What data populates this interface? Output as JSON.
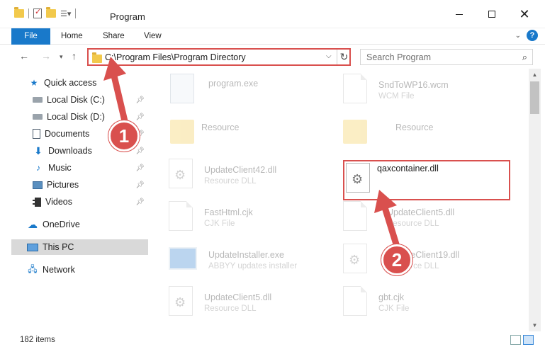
{
  "window": {
    "title": "Program",
    "minimize": "–",
    "maximize": "□",
    "close": "✕"
  },
  "ribbon": {
    "tabs": [
      "File",
      "Home",
      "Share",
      "View"
    ],
    "help": "?"
  },
  "address": {
    "path": "C:\\Program Files\\Program Directory",
    "refresh": "↻",
    "dropdown": "⌵"
  },
  "search": {
    "placeholder": "Search Program"
  },
  "nav": {
    "items": [
      {
        "label": "Quick access",
        "icon": "star-icon"
      },
      {
        "label": "Local Disk (C:)",
        "icon": "disk-icon",
        "pinned": true
      },
      {
        "label": "Local Disk (D:)",
        "icon": "disk-icon",
        "pinned": true
      },
      {
        "label": "Documents",
        "icon": "documents-icon",
        "pinned": true
      },
      {
        "label": "Downloads",
        "icon": "downloads-icon",
        "pinned": true
      },
      {
        "label": "Music",
        "icon": "music-icon",
        "pinned": true
      },
      {
        "label": "Pictures",
        "icon": "pictures-icon",
        "pinned": true
      },
      {
        "label": "Videos",
        "icon": "videos-icon",
        "pinned": true
      },
      {
        "label": "OneDrive",
        "icon": "onedrive-icon"
      },
      {
        "label": "This PC",
        "icon": "this-pc-icon",
        "selected": true
      },
      {
        "label": "Network",
        "icon": "network-icon"
      }
    ]
  },
  "files": {
    "left": [
      {
        "name": "program.exe",
        "type": "",
        "kind": "exe"
      },
      {
        "name": "Resource",
        "type": "",
        "kind": "folder"
      },
      {
        "name": "UpdateClient42.dll",
        "type": "Resource DLL",
        "kind": "dll"
      },
      {
        "name": "FastHtml.cjk",
        "type": "CJK File",
        "kind": "doc"
      },
      {
        "name": "UpdateInstaller.exe",
        "type": "ABBYY updates installer",
        "kind": "installer"
      },
      {
        "name": "UpdateClient5.dll",
        "type": "Resource DLL",
        "kind": "dll"
      }
    ],
    "right": [
      {
        "name": "SndToWP16.wcm",
        "type": "WCM File",
        "kind": "doc"
      },
      {
        "name": "Resource",
        "type": "",
        "kind": "folder"
      },
      {
        "name": "qaxcontainer.dll",
        "type": "",
        "kind": "dll",
        "highlighted": true
      },
      {
        "name": "UpdateClient5.dll",
        "type": "Resource DLL",
        "kind": "dll"
      },
      {
        "name": "UpdateClient19.dll",
        "type": "Resource DLL",
        "kind": "dll"
      },
      {
        "name": "gbt.cjk",
        "type": "CJK File",
        "kind": "doc"
      }
    ]
  },
  "status": {
    "item_count": "182 items"
  },
  "annotations": {
    "step1": "1",
    "step2": "2",
    "color": "#d9504e"
  }
}
